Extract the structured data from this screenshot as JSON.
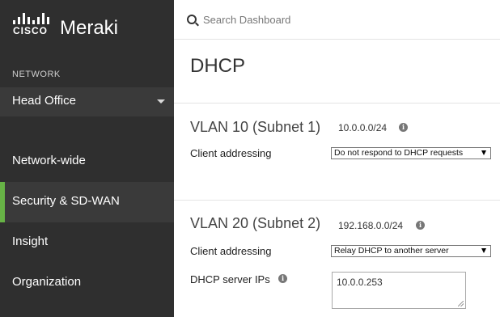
{
  "brand": {
    "company": "CISCO",
    "product": "Meraki"
  },
  "sidebar": {
    "section_label": "NETWORK",
    "network_name": "Head Office",
    "items": [
      {
        "label": "Network-wide",
        "active": false
      },
      {
        "label": "Security & SD-WAN",
        "active": true
      },
      {
        "label": "Insight",
        "active": false
      },
      {
        "label": "Organization",
        "active": false
      }
    ],
    "accent_color": "#67b346"
  },
  "search": {
    "placeholder": "Search Dashboard"
  },
  "main": {
    "title": "DHCP",
    "vlans": [
      {
        "title": "VLAN 10 (Subnet 1)",
        "subnet": "10.0.0.0/24",
        "client_addressing_label": "Client addressing",
        "client_addressing_value": "Do not respond to DHCP requests"
      },
      {
        "title": "VLAN 20 (Subnet 2)",
        "subnet": "192.168.0.0/24",
        "client_addressing_label": "Client addressing",
        "client_addressing_value": "Relay DHCP to another server",
        "dhcp_server_label": "DHCP server IPs",
        "dhcp_server_ips": "10.0.0.253"
      }
    ]
  }
}
